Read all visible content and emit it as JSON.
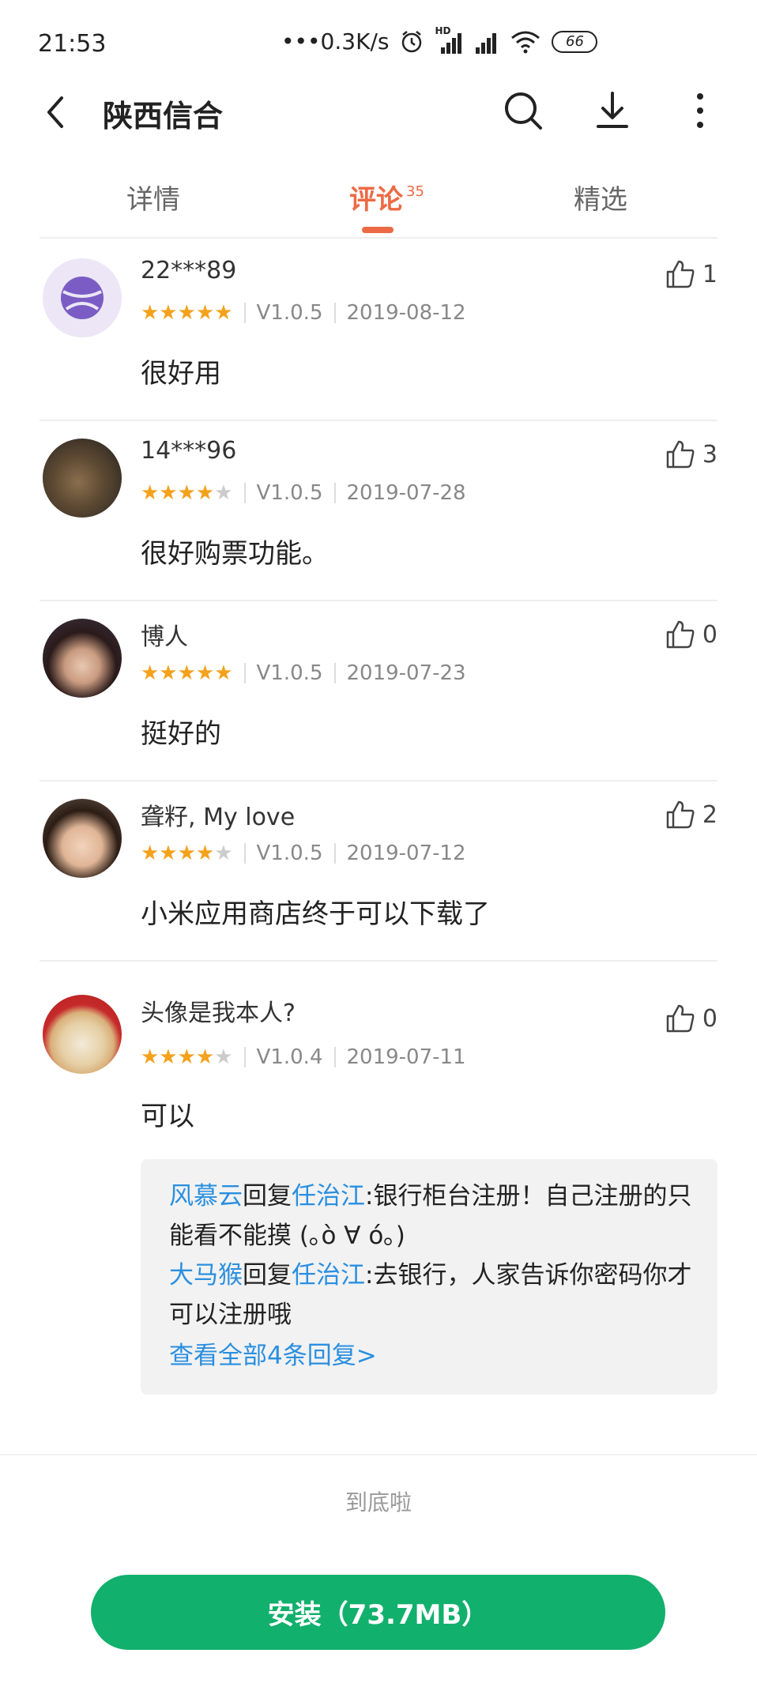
{
  "status_bar": {
    "time": "21:53",
    "network_speed": "•••0.3K/s",
    "battery": "66"
  },
  "header": {
    "title": "陕西信合"
  },
  "tabs": [
    {
      "label": "详情"
    },
    {
      "label": "评论",
      "count": "35"
    },
    {
      "label": "精选"
    }
  ],
  "reviews": [
    {
      "user": "22***89",
      "stars": 5,
      "version": "V1.0.5",
      "date": "2019-08-12",
      "likes": "1",
      "text": "很好用"
    },
    {
      "user": "14***96",
      "stars": 4,
      "version": "V1.0.5",
      "date": "2019-07-28",
      "likes": "3",
      "text": "很好购票功能。"
    },
    {
      "user": "博人",
      "stars": 5,
      "version": "V1.0.5",
      "date": "2019-07-23",
      "likes": "0",
      "text": "挺好的"
    },
    {
      "user": "聋籽, My love",
      "stars": 4,
      "version": "V1.0.5",
      "date": "2019-07-12",
      "likes": "2",
      "text": "小米应用商店终于可以下载了"
    },
    {
      "user": "头像是我本人?",
      "stars": 4,
      "version": "V1.0.4",
      "date": "2019-07-11",
      "likes": "0",
      "text": "可以",
      "replies": [
        {
          "from": "风慕云",
          "verb": "回复",
          "to": "任治江",
          "text": ":银行柜台注册！自己注册的只能看不能摸 (｡ò ∀ ó｡)"
        },
        {
          "from": "大马猴",
          "verb": "回复",
          "to": "任治江",
          "text": ":去银行，人家告诉你密码你才可以注册哦"
        }
      ],
      "more_replies": "查看全部4条回复>"
    }
  ],
  "end_text": "到底啦",
  "install_button": "安装（73.7MB）"
}
